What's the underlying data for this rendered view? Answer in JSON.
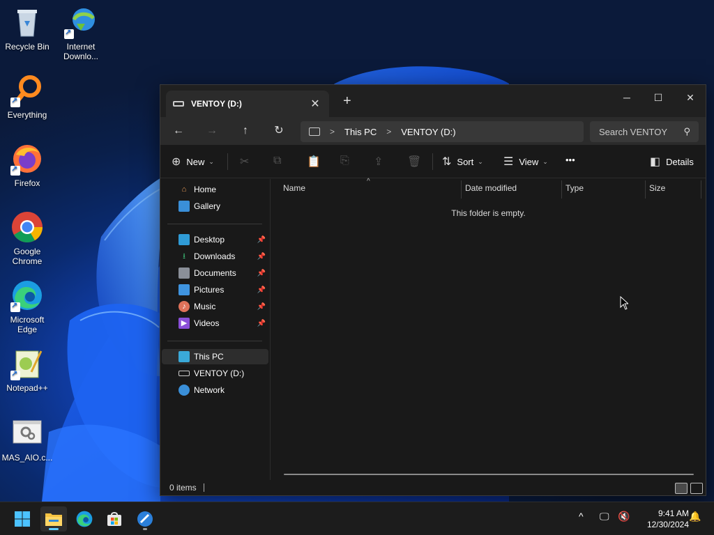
{
  "desktop": {
    "icons": [
      {
        "label": "Recycle Bin"
      },
      {
        "label": "Internet Downlo..."
      },
      {
        "label": "Everything"
      },
      {
        "label": "Firefox"
      },
      {
        "label": "Google Chrome"
      },
      {
        "label": "Microsoft Edge"
      },
      {
        "label": "Notepad++"
      },
      {
        "label": "MAS_AIO.c..."
      }
    ]
  },
  "window": {
    "tab_title": "VENTOY (D:)",
    "address": {
      "segments": [
        "This PC",
        "VENTOY (D:)"
      ]
    },
    "search": {
      "placeholder": "Search VENTOY"
    },
    "toolbar": {
      "new_label": "New",
      "sort_label": "Sort",
      "view_label": "View",
      "more_label": "•••",
      "details_label": "Details"
    },
    "nav": {
      "top": [
        {
          "label": "Home"
        },
        {
          "label": "Gallery"
        }
      ],
      "quick": [
        {
          "label": "Desktop"
        },
        {
          "label": "Downloads"
        },
        {
          "label": "Documents"
        },
        {
          "label": "Pictures"
        },
        {
          "label": "Music"
        },
        {
          "label": "Videos"
        }
      ],
      "bottom": [
        {
          "label": "This PC"
        },
        {
          "label": "VENTOY (D:)"
        },
        {
          "label": "Network"
        }
      ]
    },
    "columns": [
      "Name",
      "Date modified",
      "Type",
      "Size"
    ],
    "empty_message": "This folder is empty.",
    "status": {
      "items": "0 items"
    }
  },
  "taskbar": {
    "time": "9:41 AM",
    "date": "12/30/2024",
    "accent": "#60cdff"
  }
}
